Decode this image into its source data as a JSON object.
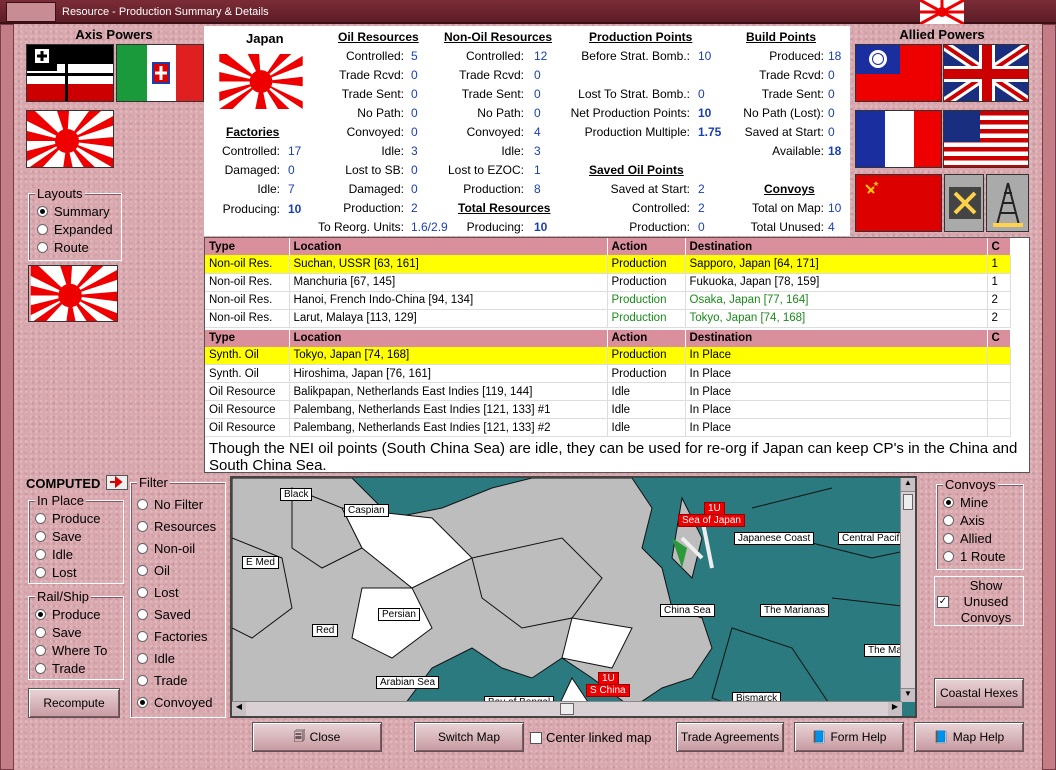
{
  "window": {
    "title": "Resource - Production Summary & Details"
  },
  "axis": {
    "title": "Axis Powers"
  },
  "allied": {
    "title": "Allied Powers"
  },
  "layouts": {
    "legend": "Layouts",
    "options": [
      "Summary",
      "Expanded",
      "Route"
    ],
    "selected": 0
  },
  "computed": {
    "label": "COMPUTED"
  },
  "in_place": {
    "legend": "In Place",
    "options": [
      "Produce",
      "Save",
      "Idle",
      "Lost"
    ]
  },
  "rail_ship": {
    "legend": "Rail/Ship",
    "options": [
      "Produce",
      "Save",
      "Where To",
      "Trade"
    ],
    "selected": 0
  },
  "filter": {
    "legend": "Filter",
    "options": [
      "No Filter",
      "Resources",
      "Non-oil",
      "Oil",
      "Lost",
      "Saved",
      "Factories",
      "Idle",
      "Trade",
      "Convoyed"
    ],
    "selected": 9
  },
  "recompute": "Recompute",
  "summary": {
    "country": "Japan",
    "factories": {
      "title": "Factories",
      "rows": [
        [
          "Controlled:",
          "17"
        ],
        [
          "Damaged:",
          "0"
        ],
        [
          "Idle:",
          "7"
        ],
        [
          "Producing:",
          "10"
        ]
      ]
    },
    "oil": {
      "title": "Oil Resources",
      "rows": [
        [
          "Controlled:",
          "5"
        ],
        [
          "Trade Rcvd:",
          "0"
        ],
        [
          "Trade Sent:",
          "0"
        ],
        [
          "No Path:",
          "0"
        ],
        [
          "Convoyed:",
          "0"
        ],
        [
          "Idle:",
          "3"
        ],
        [
          "Lost to SB:",
          "0"
        ],
        [
          "Damaged:",
          "0"
        ],
        [
          "Production:",
          "2"
        ]
      ],
      "reorg_label": "To Reorg. Units:",
      "reorg_value": "1.6/2.9"
    },
    "nonoil": {
      "title": "Non-Oil Resources",
      "rows": [
        [
          "Controlled:",
          "12"
        ],
        [
          "Trade Rcvd:",
          "0"
        ],
        [
          "Trade Sent:",
          "0"
        ],
        [
          "No Path:",
          "0"
        ],
        [
          "Convoyed:",
          "4"
        ],
        [
          "Idle:",
          "3"
        ],
        [
          "Lost to EZOC:",
          "1"
        ],
        [
          "Production:",
          "8"
        ]
      ]
    },
    "total": {
      "title": "Total Resources",
      "label": "Producing:",
      "value": "10"
    },
    "prod": {
      "title": "Production Points",
      "rows": [
        [
          "Before Strat. Bomb.:",
          "10"
        ],
        [
          "",
          ""
        ],
        [
          "Lost To Strat. Bomb.:",
          "0"
        ],
        [
          "Net Production Points:",
          "10"
        ],
        [
          "Production Multiple:",
          "1.75"
        ]
      ]
    },
    "saved": {
      "title": "Saved Oil Points",
      "rows": [
        [
          "Saved at Start:",
          "2"
        ],
        [
          "Controlled:",
          "2"
        ],
        [
          "Production:",
          "0"
        ]
      ]
    },
    "build": {
      "title": "Build Points",
      "rows": [
        [
          "Produced:",
          "18"
        ],
        [
          "Trade Rcvd:",
          "0"
        ],
        [
          "Trade Sent:",
          "0"
        ],
        [
          "No Path (Lost):",
          "0"
        ],
        [
          "Saved at Start:",
          "0"
        ],
        [
          "Available:",
          "18"
        ]
      ]
    },
    "convoys": {
      "title": "Convoys",
      "rows": [
        [
          "Total on Map:",
          "10"
        ],
        [
          "Total Unused:",
          "4"
        ]
      ]
    }
  },
  "table1": {
    "headers": [
      "Type",
      "Location",
      "Action",
      "Destination",
      "C"
    ],
    "rows": [
      [
        "Non-oil Res.",
        "Suchan, USSR [63, 161]",
        "Production",
        "Sapporo, Japan [64, 171]",
        "1"
      ],
      [
        "Non-oil Res.",
        "Manchuria [67, 145]",
        "Production",
        "Fukuoka, Japan [78, 159]",
        "1"
      ],
      [
        "Non-oil Res.",
        "Hanoi, French Indo-China [94, 134]",
        "Production",
        "Osaka, Japan [77, 164]",
        "2"
      ],
      [
        "Non-oil Res.",
        "Larut, Malaya [113, 129]",
        "Production",
        "Tokyo, Japan [74, 168]",
        "2"
      ]
    ]
  },
  "table2": {
    "headers": [
      "Type",
      "Location",
      "Action",
      "Destination",
      "C"
    ],
    "rows": [
      [
        "Synth. Oil",
        "Tokyo, Japan [74, 168]",
        "Production",
        "In Place",
        ""
      ],
      [
        "Synth. Oil",
        "Hiroshima, Japan [76, 161]",
        "Production",
        "In Place",
        ""
      ],
      [
        "Oil Resource",
        "Balikpapan, Netherlands East Indies [119, 144]",
        "Idle",
        "In Place",
        ""
      ],
      [
        "Oil Resource",
        "Palembang, Netherlands East Indies [121, 133] #1",
        "Idle",
        "In Place",
        ""
      ],
      [
        "Oil Resource",
        "Palembang, Netherlands East Indies [121, 133] #2",
        "Idle",
        "In Place",
        ""
      ]
    ]
  },
  "note": "Though the NEI oil points (South China Sea) are idle, they can be used for re-org if Japan can keep CP's in the China and South China Sea.",
  "map": {
    "labels": [
      "Black",
      "Caspian",
      "E Med",
      "Persian",
      "Red",
      "Arabian Sea",
      "Bay of Bengal",
      "Bismarck",
      "The Marianas",
      "China Sea",
      "Japanese Coast",
      "Central Pacif",
      "The Ma"
    ],
    "red_labels": [
      "1U",
      "Sea of Japan",
      "1U",
      "S China"
    ]
  },
  "convoys_box": {
    "legend": "Convoys",
    "options": [
      "Mine",
      "Axis",
      "Allied",
      "1 Route"
    ],
    "selected": 0
  },
  "show_unused": {
    "label": "Show Unused Convoys",
    "checked": true
  },
  "buttons": {
    "coastal": "Coastal Hexes",
    "close": "Close",
    "switch_map": "Switch Map",
    "center_linked": "Center linked map",
    "trade": "Trade Agreements",
    "form_help": "Form Help",
    "map_help": "Map Help"
  },
  "colors": {
    "header_pink": "#d9909c",
    "highlight": "#ffff00",
    "link_blue": "#1a3fb0",
    "green_text": "#1a8a1a",
    "sea": "#2b7a80"
  }
}
